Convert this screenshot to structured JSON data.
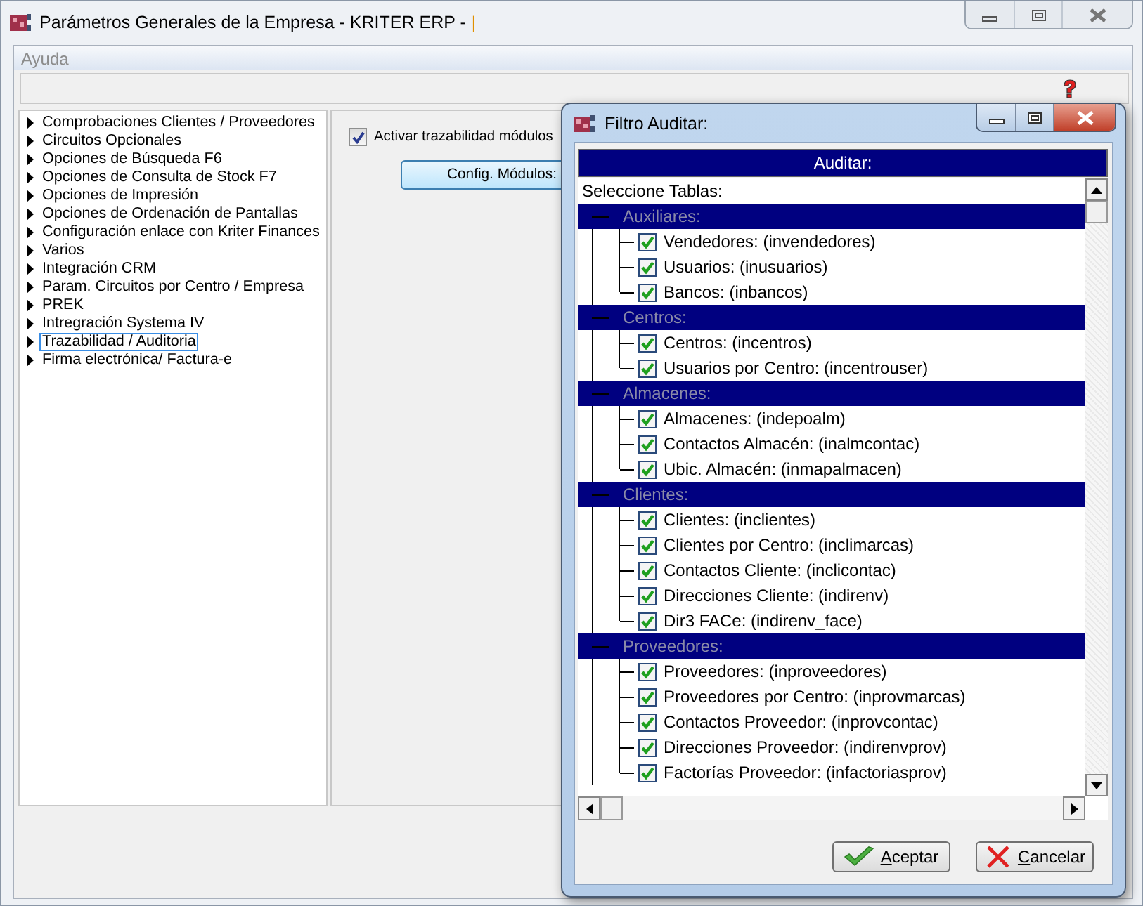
{
  "window": {
    "title": "Parámetros Generales de la Empresa - KRITER ERP -",
    "cursor": "|"
  },
  "menu": [
    {
      "label": "Ayuda",
      "disabled": true
    }
  ],
  "tree": [
    {
      "label": "Comprobaciones Clientes / Proveedores",
      "selected": false
    },
    {
      "label": "Circuitos Opcionales",
      "selected": false
    },
    {
      "label": "Opciones de Búsqueda F6",
      "selected": false
    },
    {
      "label": "Opciones de Consulta de Stock F7",
      "selected": false
    },
    {
      "label": "Opciones de Impresión",
      "selected": false
    },
    {
      "label": "Opciones de Ordenación de Pantallas",
      "selected": false
    },
    {
      "label": "Configuración enlace con Kriter Finances",
      "selected": false
    },
    {
      "label": "Varios",
      "selected": false
    },
    {
      "label": "Integración CRM",
      "selected": false
    },
    {
      "label": "Param. Circuitos por Centro / Empresa",
      "selected": false
    },
    {
      "label": "PREK",
      "selected": false
    },
    {
      "label": "Intregración Systema IV",
      "selected": false
    },
    {
      "label": "Trazabilidad / Auditoria",
      "selected": true
    },
    {
      "label": "Firma electrónica/ Factura-e",
      "selected": false
    }
  ],
  "options": {
    "checkbox": {
      "label": "Activar trazabilidad módulos",
      "checked": true
    },
    "button": "Config. Módulos:"
  },
  "dialog": {
    "title": "Filtro Auditar:",
    "header": "Auditar:",
    "list_title": "Seleccione Tablas:",
    "groups": [
      {
        "label": "Auxiliares:",
        "children": [
          {
            "label": "Vendedores: (invendedores)",
            "checked": true
          },
          {
            "label": "Usuarios: (inusuarios)",
            "checked": true
          },
          {
            "label": "Bancos: (inbancos)",
            "checked": true
          }
        ]
      },
      {
        "label": "Centros:",
        "children": [
          {
            "label": "Centros: (incentros)",
            "checked": true
          },
          {
            "label": "Usuarios por Centro: (incentrouser)",
            "checked": true
          }
        ]
      },
      {
        "label": "Almacenes:",
        "children": [
          {
            "label": "Almacenes: (indepoalm)",
            "checked": true
          },
          {
            "label": "Contactos Almacén: (inalmcontac)",
            "checked": true
          },
          {
            "label": "Ubic. Almacén: (inmapalmacen)",
            "checked": true
          }
        ]
      },
      {
        "label": "Clientes:",
        "children": [
          {
            "label": "Clientes: (inclientes)",
            "checked": true
          },
          {
            "label": "Clientes por Centro: (inclimarcas)",
            "checked": true
          },
          {
            "label": "Contactos Cliente: (inclicontac)",
            "checked": true
          },
          {
            "label": "Direcciones Cliente: (indirenv)",
            "checked": true
          },
          {
            "label": "Dir3 FACe: (indirenv_face)",
            "checked": true
          }
        ]
      },
      {
        "label": "Proveedores:",
        "children": [
          {
            "label": "Proveedores: (inproveedores)",
            "checked": true
          },
          {
            "label": "Proveedores por Centro: (inprovmarcas)",
            "checked": true
          },
          {
            "label": "Contactos Proveedor: (inprovcontac)",
            "checked": true
          },
          {
            "label": "Direcciones Proveedor: (indirenvprov)",
            "checked": true
          },
          {
            "label": "Factorías Proveedor: (infactoriasprov)",
            "checked": true
          }
        ]
      }
    ],
    "buttons": [
      {
        "label": "Aceptar",
        "kind": "accept"
      },
      {
        "label": "Cancelar",
        "kind": "cancel"
      }
    ]
  }
}
